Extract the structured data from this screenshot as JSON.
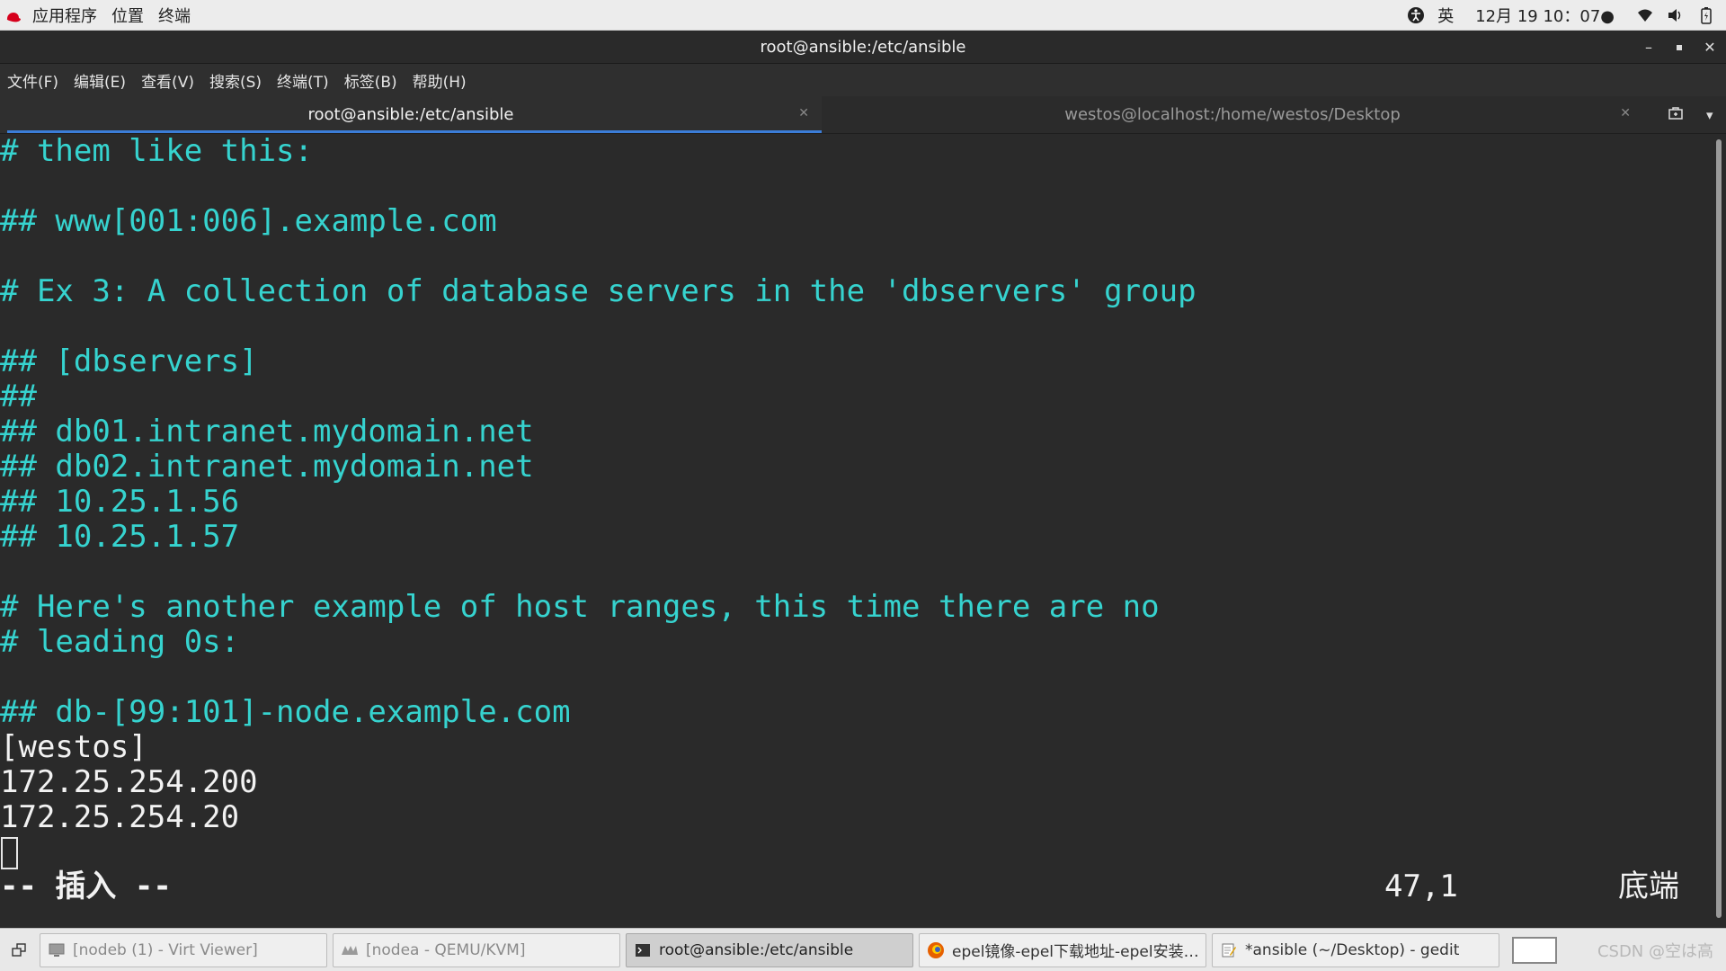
{
  "topbar": {
    "apps_menu": "应用程序",
    "places_menu": "位置",
    "terminal_menu": "终端",
    "input_method": "英",
    "clock": "12月 19 10：07●"
  },
  "window": {
    "title": "root@ansible:/etc/ansible"
  },
  "menubar": {
    "items": [
      "文件(F)",
      "编辑(E)",
      "查看(V)",
      "搜索(S)",
      "终端(T)",
      "标签(B)",
      "帮助(H)"
    ]
  },
  "tabs": [
    {
      "label": "root@ansible:/etc/ansible",
      "active": true
    },
    {
      "label": "westos@localhost:/home/westos/Desktop",
      "active": false
    }
  ],
  "terminal": {
    "lines": [
      {
        "text": "# them like this:",
        "kind": "comment"
      },
      {
        "text": "",
        "kind": "comment"
      },
      {
        "text": "## www[001:006].example.com",
        "kind": "comment"
      },
      {
        "text": "",
        "kind": "comment"
      },
      {
        "text": "# Ex 3: A collection of database servers in the 'dbservers' group",
        "kind": "comment"
      },
      {
        "text": "",
        "kind": "comment"
      },
      {
        "text": "## [dbservers]",
        "kind": "comment"
      },
      {
        "text": "##",
        "kind": "comment"
      },
      {
        "text": "## db01.intranet.mydomain.net",
        "kind": "comment"
      },
      {
        "text": "## db02.intranet.mydomain.net",
        "kind": "comment"
      },
      {
        "text": "## 10.25.1.56",
        "kind": "comment"
      },
      {
        "text": "## 10.25.1.57",
        "kind": "comment"
      },
      {
        "text": "",
        "kind": "comment"
      },
      {
        "text": "# Here's another example of host ranges, this time there are no",
        "kind": "comment"
      },
      {
        "text": "# leading 0s:",
        "kind": "comment"
      },
      {
        "text": "",
        "kind": "comment"
      },
      {
        "text": "## db-[99:101]-node.example.com",
        "kind": "comment"
      },
      {
        "text": "[westos]",
        "kind": "plain"
      },
      {
        "text": "172.25.254.200",
        "kind": "plain"
      },
      {
        "text": "172.25.254.20",
        "kind": "plain"
      }
    ],
    "status_mode": "-- 插入 --",
    "status_position": "47,1",
    "status_scroll": "底端"
  },
  "taskbar": {
    "tasks": [
      {
        "label": "[nodeb (1) - Virt Viewer]",
        "icon": "monitor-icon",
        "state": "dim"
      },
      {
        "label": "[nodea - QEMU/KVM]",
        "icon": "vm-icon",
        "state": "dim"
      },
      {
        "label": "root@ansible:/etc/ansible",
        "icon": "terminal-icon",
        "state": "active"
      },
      {
        "label": "epel镜像-epel下载地址-epel安装教…",
        "icon": "firefox-icon",
        "state": "normal"
      },
      {
        "label": "*ansible (~/Desktop) - gedit",
        "icon": "text-editor-icon",
        "state": "normal"
      }
    ],
    "watermark": "CSDN @空は高"
  }
}
